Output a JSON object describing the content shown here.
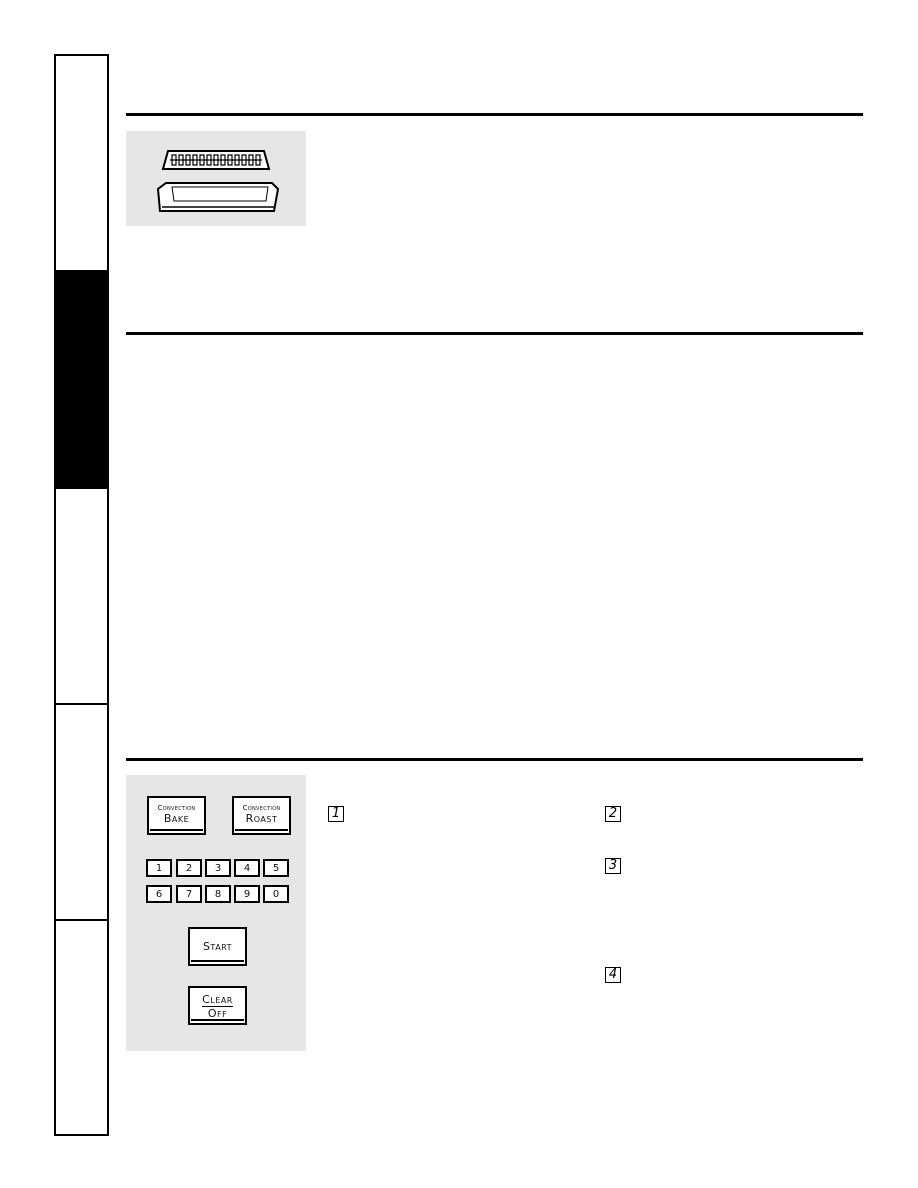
{
  "sidebar": {
    "tabs": [
      {
        "name": "tab-1",
        "active": false
      },
      {
        "name": "tab-2",
        "active": true
      },
      {
        "name": "tab-3",
        "active": false
      },
      {
        "name": "tab-4",
        "active": false
      },
      {
        "name": "tab-5",
        "active": false
      }
    ]
  },
  "illustrations": {
    "broiler_pan": "broiler-pan-and-grid-illustration"
  },
  "control_panel": {
    "convection_bake": {
      "small": "Convection",
      "big": "Bake"
    },
    "convection_roast": {
      "small": "Convection",
      "big": "Roast"
    },
    "number_pad": [
      "1",
      "2",
      "3",
      "4",
      "5",
      "6",
      "7",
      "8",
      "9",
      "0"
    ],
    "start": "Start",
    "clear_off": {
      "top": "Clear",
      "bottom": "Off"
    }
  },
  "steps": [
    "1",
    "2",
    "3",
    "4"
  ]
}
